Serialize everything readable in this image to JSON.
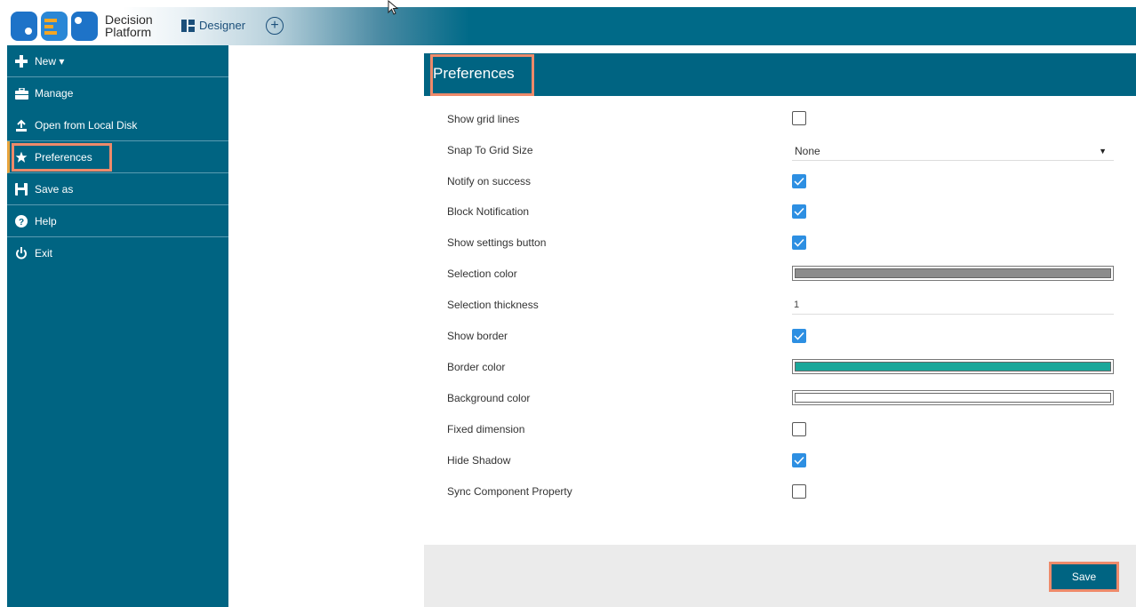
{
  "app": {
    "logo_line1": "Decision",
    "logo_line2": "Platform",
    "designer_label": "Designer"
  },
  "sidebar": {
    "items": [
      {
        "label": "New ▾",
        "icon": "plus-icon"
      },
      {
        "label": "Manage",
        "icon": "briefcase-icon"
      },
      {
        "label": "Open from Local Disk",
        "icon": "upload-icon"
      },
      {
        "label": "Preferences",
        "icon": "star-icon"
      },
      {
        "label": "Save as",
        "icon": "save-icon"
      },
      {
        "label": "Help",
        "icon": "help-icon"
      },
      {
        "label": "Exit",
        "icon": "power-icon"
      }
    ]
  },
  "panel": {
    "title": "Preferences",
    "rows": [
      {
        "label": "Show grid lines",
        "type": "checkbox",
        "checked": false
      },
      {
        "label": "Snap To Grid Size",
        "type": "select",
        "value": "None"
      },
      {
        "label": "Notify on success",
        "type": "checkbox",
        "checked": true
      },
      {
        "label": "Block Notification",
        "type": "checkbox",
        "checked": true
      },
      {
        "label": "Show settings button",
        "type": "checkbox",
        "checked": true
      },
      {
        "label": "Selection color",
        "type": "color",
        "value": "#8c8c8c"
      },
      {
        "label": "Selection thickness",
        "type": "input",
        "value": "1"
      },
      {
        "label": "Show border",
        "type": "checkbox",
        "checked": true
      },
      {
        "label": "Border color",
        "type": "color",
        "value": "#1aa79a"
      },
      {
        "label": "Background color",
        "type": "color",
        "value": "#ffffff"
      },
      {
        "label": "Fixed dimension",
        "type": "checkbox",
        "checked": false
      },
      {
        "label": "Hide Shadow",
        "type": "checkbox",
        "checked": true
      },
      {
        "label": "Sync Component Property",
        "type": "checkbox",
        "checked": false
      }
    ],
    "save_label": "Save"
  },
  "colors": {
    "primary": "#006482",
    "highlight": "#ee8a6a",
    "checkbox_checked": "#2d8fe2"
  }
}
